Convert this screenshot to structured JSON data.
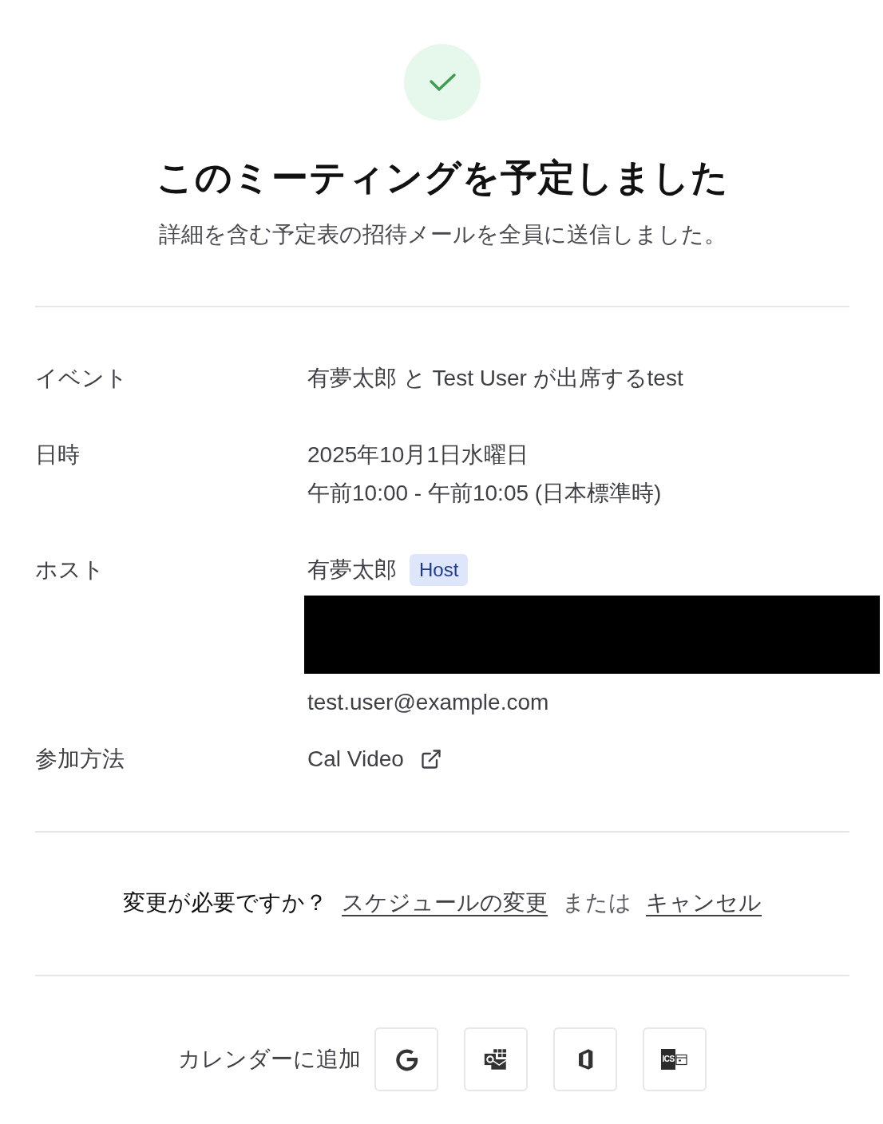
{
  "status": {
    "title": "このミーティングを予定しました",
    "subtitle": "詳細を含む予定表の招待メールを全員に送信しました。"
  },
  "details": [
    {
      "kind": "text",
      "label": "イベント",
      "lines": [
        "有夢太郎 と Test User が出席するtest"
      ]
    },
    {
      "kind": "text",
      "label": "日時",
      "lines": [
        "2025年10月1日水曜日",
        "午前10:00 - 午前10:05 (日本標準時)"
      ]
    },
    {
      "kind": "people",
      "label": "ホスト",
      "host": {
        "name": "有夢太郎",
        "badge": "Host"
      },
      "redacted": true,
      "lines": [
        "test.user@example.com"
      ]
    },
    {
      "kind": "link",
      "label": "参加方法",
      "link": "Cal Video"
    }
  ],
  "change": {
    "prompt": "変更が必要ですか？",
    "reschedule_link": "スケジュールの変更",
    "separator": "または",
    "cancel_link": "キャンセル"
  },
  "add_to_calendar": {
    "label": "カレンダーに追加",
    "buttons": [
      {
        "kind": "google"
      },
      {
        "kind": "outlook"
      },
      {
        "kind": "office"
      },
      {
        "kind": "ics",
        "label": "ICS"
      }
    ]
  }
}
